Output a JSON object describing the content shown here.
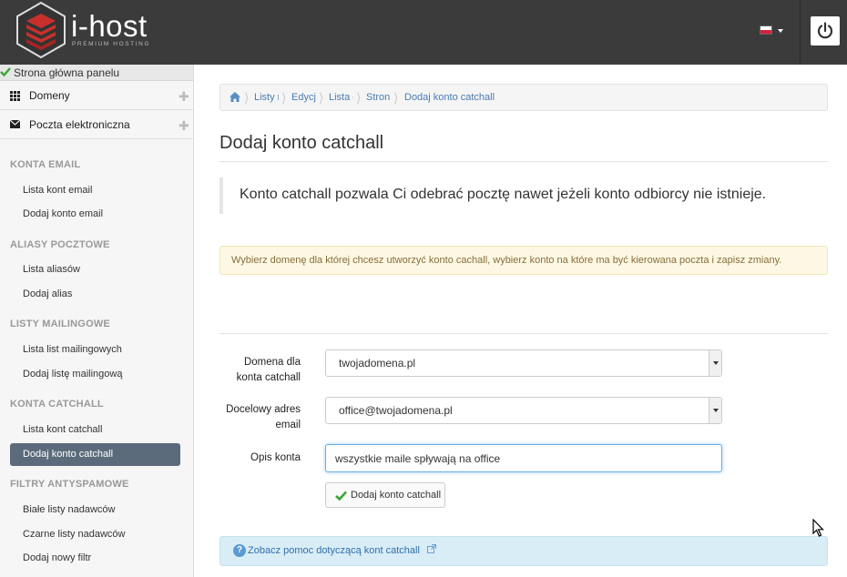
{
  "header": {
    "brand": "i-host",
    "brand_sub": "PREMIUM HOSTING",
    "flag_colors": [
      "#ffffff",
      "#d4213d"
    ],
    "power_icon": "power-icon"
  },
  "sidebar": {
    "home_label": "Strona główna panelu",
    "main_items": [
      {
        "label": "Domeny",
        "icon": "grid-icon"
      },
      {
        "label": "Poczta elektroniczna",
        "icon": "envelope-icon"
      }
    ],
    "sections": [
      {
        "title": "KONTA EMAIL",
        "items": [
          "Lista kont email",
          "Dodaj konto email"
        ]
      },
      {
        "title": "ALIASY POCZTOWE",
        "items": [
          "Lista aliasów",
          "Dodaj alias"
        ]
      },
      {
        "title": "LISTY MAILINGOWE",
        "items": [
          "Lista list mailingowych",
          "Dodaj listę mailingową"
        ]
      },
      {
        "title": "KONTA CATCHALL",
        "items": [
          "Lista kont catchall",
          "Dodaj konto catchall"
        ]
      },
      {
        "title": "FILTRY ANTYSPAMOWE",
        "items": [
          "Białe listy nadawców",
          "Czarne listy nadawców",
          "Dodaj nowy filtr"
        ]
      }
    ],
    "active_item": "Dodaj konto catchall",
    "active_color": "#5b6b7b"
  },
  "breadcrumb": [
    "Listy r",
    "Edycj",
    "Lista c",
    "Stron",
    "Dodaj konto catchall"
  ],
  "main": {
    "title": "Dodaj konto catchall",
    "lead": "Konto catchall pozwala Ci odebrać pocztę nawet jeżeli konto odbiorcy nie istnieje.",
    "warning": "Wybierz domenę dla której chcesz utworzyć konto cachall, wybierz konto na które ma być kierowana poczta i zapisz zmiany."
  },
  "form": {
    "domain_label_1": "Domena dla",
    "domain_label_2": "konta catchall",
    "domain_value": "twojadomena.pl",
    "target_label_1": "Docelowy adres",
    "target_label_2": "email",
    "target_value": "office@twojadomena.pl",
    "desc_label": "Opis konta",
    "desc_value": "wszystkie maile spływają na office",
    "submit_label": "Dodaj konto catchall"
  },
  "help": {
    "link": "Zobacz pomoc dotyczącą kont catchall"
  }
}
